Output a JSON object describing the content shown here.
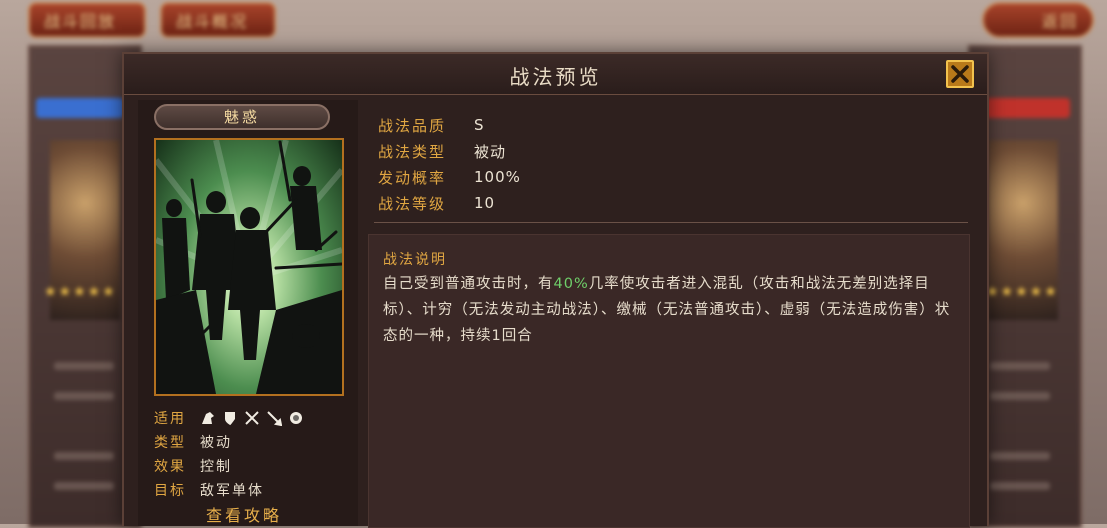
{
  "background": {
    "tabs": [
      "战斗回放",
      "战斗概况",
      "返回"
    ]
  },
  "dialog": {
    "title": "战法预览",
    "tactic_name": "魅惑",
    "info": [
      {
        "key": "适用",
        "icons": [
          "cavalry-icon",
          "shield-icon",
          "crossed-swords-icon",
          "spear-icon",
          "siege-icon"
        ]
      },
      {
        "key": "类型",
        "value": "被动"
      },
      {
        "key": "效果",
        "value": "控制"
      },
      {
        "key": "目标",
        "value": "敌军单体"
      }
    ],
    "strategy_link": "查看攻略",
    "stats": [
      {
        "key": "战法品质",
        "value": "S"
      },
      {
        "key": "战法类型",
        "value": "被动"
      },
      {
        "key": "发动概率",
        "value": "100%"
      },
      {
        "key": "战法等级",
        "value": "10"
      }
    ],
    "description": {
      "title": "战法说明",
      "before": "自己受到普通攻击时，有",
      "highlight": "40%",
      "after": "几率使攻击者进入混乱（攻击和战法无差别选择目标）、计穷（无法发动主动战法）、缴械（无法普通攻击）、虚弱（无法造成伤害）状态的一种，持续1回合"
    }
  },
  "colors": {
    "accent": "#e0a642",
    "highlight": "#6fcf6a",
    "close_button": "#b8791a"
  }
}
